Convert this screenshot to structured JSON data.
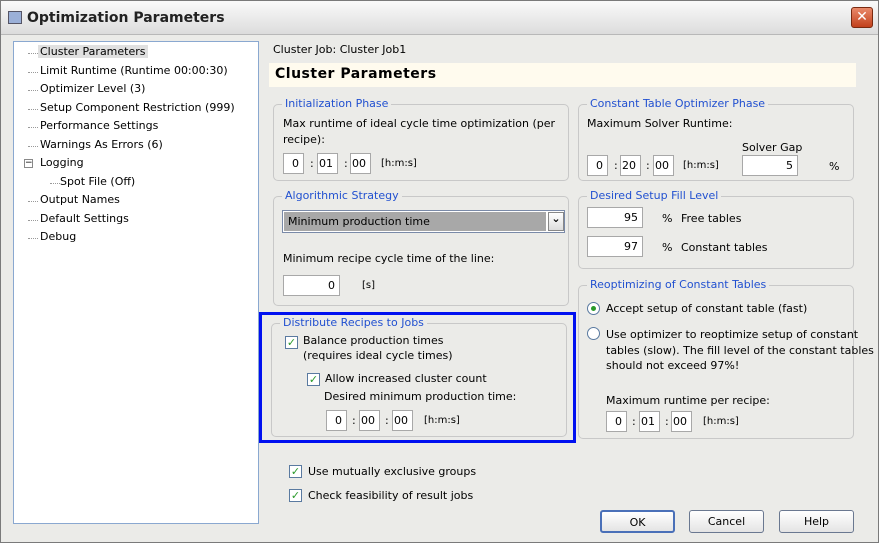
{
  "window": {
    "title": "Optimization Parameters",
    "close": "✕"
  },
  "tree": {
    "items": [
      "Cluster Parameters",
      "Limit Runtime (Runtime 00:00:30)",
      "Optimizer Level (3)",
      "Setup Component Restriction (999)",
      "Performance Settings",
      "Warnings As Errors (6)",
      "Logging",
      "Spot File (Off)",
      "Output Names",
      "Default Settings",
      "Debug"
    ],
    "collapse": "−"
  },
  "header": {
    "job": "Cluster Job: Cluster Job1",
    "title": "Cluster Parameters"
  },
  "init": {
    "label": "Initialization Phase",
    "desc1": "Max runtime of ideal cycle time optimization (per",
    "desc2": "recipe):",
    "h": "0",
    "m": "01",
    "s": "00",
    "unit": "[h:m:s]"
  },
  "algo": {
    "label": "Algorithmic Strategy",
    "selected": "Minimum production time",
    "min_label": "Minimum recipe cycle time of the line:",
    "min_value": "0",
    "unit": "[s]"
  },
  "distribute": {
    "label": "Distribute Recipes to Jobs",
    "balance1": "Balance production times",
    "balance2": "(requires ideal cycle times)",
    "balance_checked": true,
    "allow": "Allow increased cluster count",
    "allow_checked": true,
    "desired": "Desired minimum production time:",
    "h": "0",
    "m": "00",
    "s": "00",
    "unit": "[h:m:s]"
  },
  "constant": {
    "label": "Constant Table Optimizer Phase",
    "max": "Maximum Solver Runtime:",
    "h": "0",
    "m": "20",
    "s": "00",
    "unit": "[h:m:s]",
    "gap_label": "Solver Gap",
    "gap": "5",
    "pct": "%"
  },
  "fill": {
    "label": "Desired Setup Fill Level",
    "free": "95",
    "free_label": "Free tables",
    "constant": "97",
    "constant_label": "Constant tables",
    "pct": "%"
  },
  "reopt": {
    "label": "Reoptimizing of Constant Tables",
    "opt1": "Accept setup of constant table (fast)",
    "opt2a": "Use optimizer to reoptimize setup of constant",
    "opt2b": "tables (slow). The fill level of the constant tables",
    "opt2c": "should not exceed 97%!",
    "selected": 0,
    "max": "Maximum runtime per recipe:",
    "h": "0",
    "m": "01",
    "s": "00",
    "unit": "[h:m:s]"
  },
  "options": {
    "mutex": "Use mutually exclusive groups",
    "feas": "Check feasibility of result jobs"
  },
  "buttons": {
    "ok": "OK",
    "cancel": "Cancel",
    "help": "Help"
  },
  "colon": ":",
  "check": "✓",
  "dropdown_arrow": "⌄"
}
